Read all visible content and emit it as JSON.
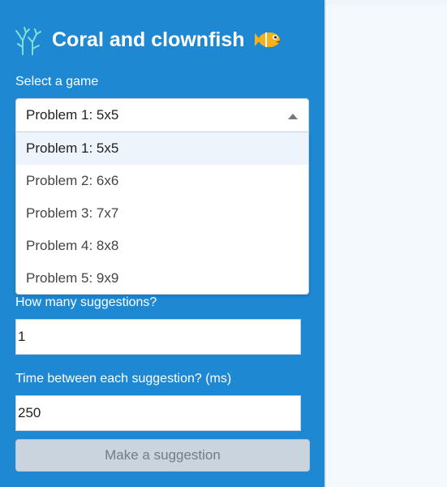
{
  "sidebar": {
    "title": "Coral and clownfish",
    "icons": {
      "left": "coral-icon",
      "right": "clownfish-icon"
    },
    "game_label": "Select a game",
    "game_select": {
      "selected": "Problem 1: 5x5",
      "options": [
        "Problem 1: 5x5",
        "Problem 2: 6x6",
        "Problem 3: 7x7",
        "Problem 4: 8x8",
        "Problem 5: 9x9"
      ]
    },
    "suggestions_label": "How many suggestions?",
    "suggestions_value": "1",
    "time_label": "Time between each suggestion? (ms)",
    "time_value": "250",
    "suggest_button": "Make a suggestion"
  },
  "colors": {
    "sidebar_bg": "#1f88d3",
    "button_disabled_bg": "#c9d4de",
    "fish_orange": "#f5b21a"
  }
}
